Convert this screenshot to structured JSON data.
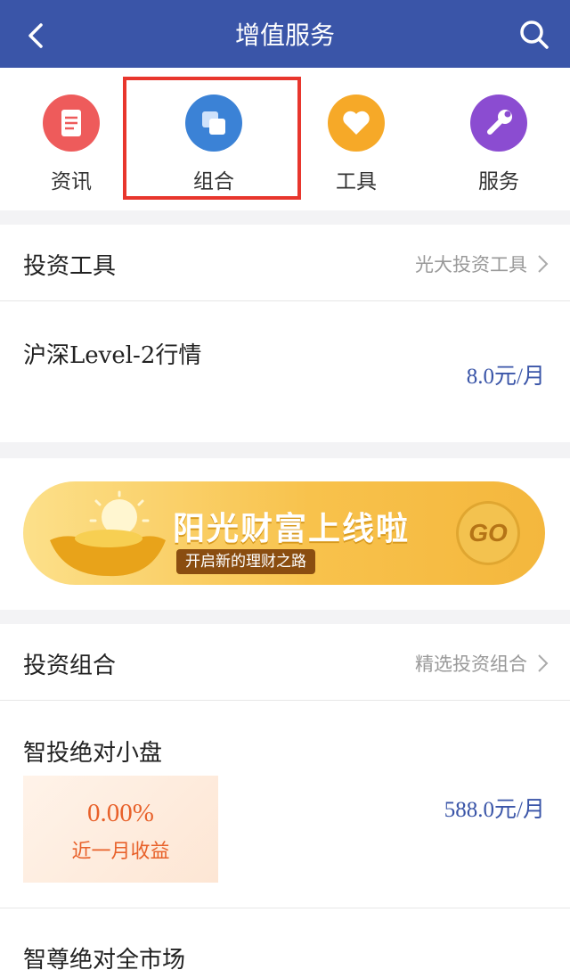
{
  "header": {
    "title": "增值服务",
    "back_icon": "chevron-left-icon",
    "search_icon": "search-icon",
    "bg": "#3a55a8"
  },
  "nav": [
    {
      "label": "资讯",
      "icon": "document-icon",
      "color": "#ee5b5b"
    },
    {
      "label": "组合",
      "icon": "layers-icon",
      "color": "#3b82d6"
    },
    {
      "label": "工具",
      "icon": "heart-icon",
      "color": "#f6a928"
    },
    {
      "label": "服务",
      "icon": "wrench-icon",
      "color": "#8b4cd1"
    }
  ],
  "tools_section": {
    "title": "投资工具",
    "link": "光大投资工具"
  },
  "tool_item": {
    "name": "沪深Level-2行情",
    "price": "8.0元/月"
  },
  "banner": {
    "headline": "阳光财富上线啦",
    "sub": "开启新的理财之路",
    "go": "GO"
  },
  "portfolio_section": {
    "title": "投资组合",
    "link": "精选投资组合"
  },
  "portfolio_item": {
    "name": "智投绝对小盘",
    "return_value": "0.00%",
    "return_label": "近一月收益",
    "price": "588.0元/月"
  },
  "portfolio_item2": {
    "name": "智尊绝对全市场"
  }
}
